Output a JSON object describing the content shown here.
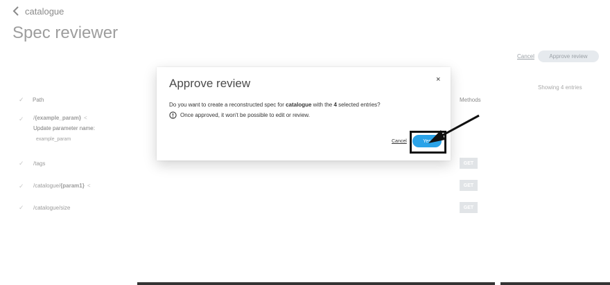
{
  "breadcrumb": {
    "label": "catalogue"
  },
  "page": {
    "title": "Spec reviewer"
  },
  "toolbar": {
    "cancel_label": "Cancel",
    "approve_label": "Approve review"
  },
  "table": {
    "showing_text": "Showing 4 entries",
    "headers": {
      "path": "Path",
      "methods": "Methods"
    },
    "rows": [
      {
        "path_prefix": "/",
        "path_param": "{example_param}",
        "param_label": "Update parameter name:",
        "param_value": "example_param",
        "method": ""
      },
      {
        "path_prefix": "/tags",
        "path_param": "",
        "method": "GET"
      },
      {
        "path_prefix": "/catalogue/",
        "path_param": "{param1}",
        "method": "GET"
      },
      {
        "path_prefix": "/catalogue/size",
        "path_param": "",
        "method": "GET"
      }
    ]
  },
  "modal": {
    "title": "Approve review",
    "close_glyph": "×",
    "body_prefix": "Do you want to create a reconstructed spec for ",
    "body_spec": "catalogue",
    "body_middle": " with the ",
    "body_count": "4",
    "body_suffix": " selected entries?",
    "warning": "Once approved, it won't be possible to edit or review.",
    "cancel_label": "Cancel",
    "yes_label": "Yes"
  },
  "icons": {
    "back": "chevron-left-icon",
    "warning": "exclamation-circle-icon",
    "share": "share-icon",
    "check": "check-icon"
  },
  "colors": {
    "accent": "#2ba3e8",
    "annotation": "#111111"
  }
}
